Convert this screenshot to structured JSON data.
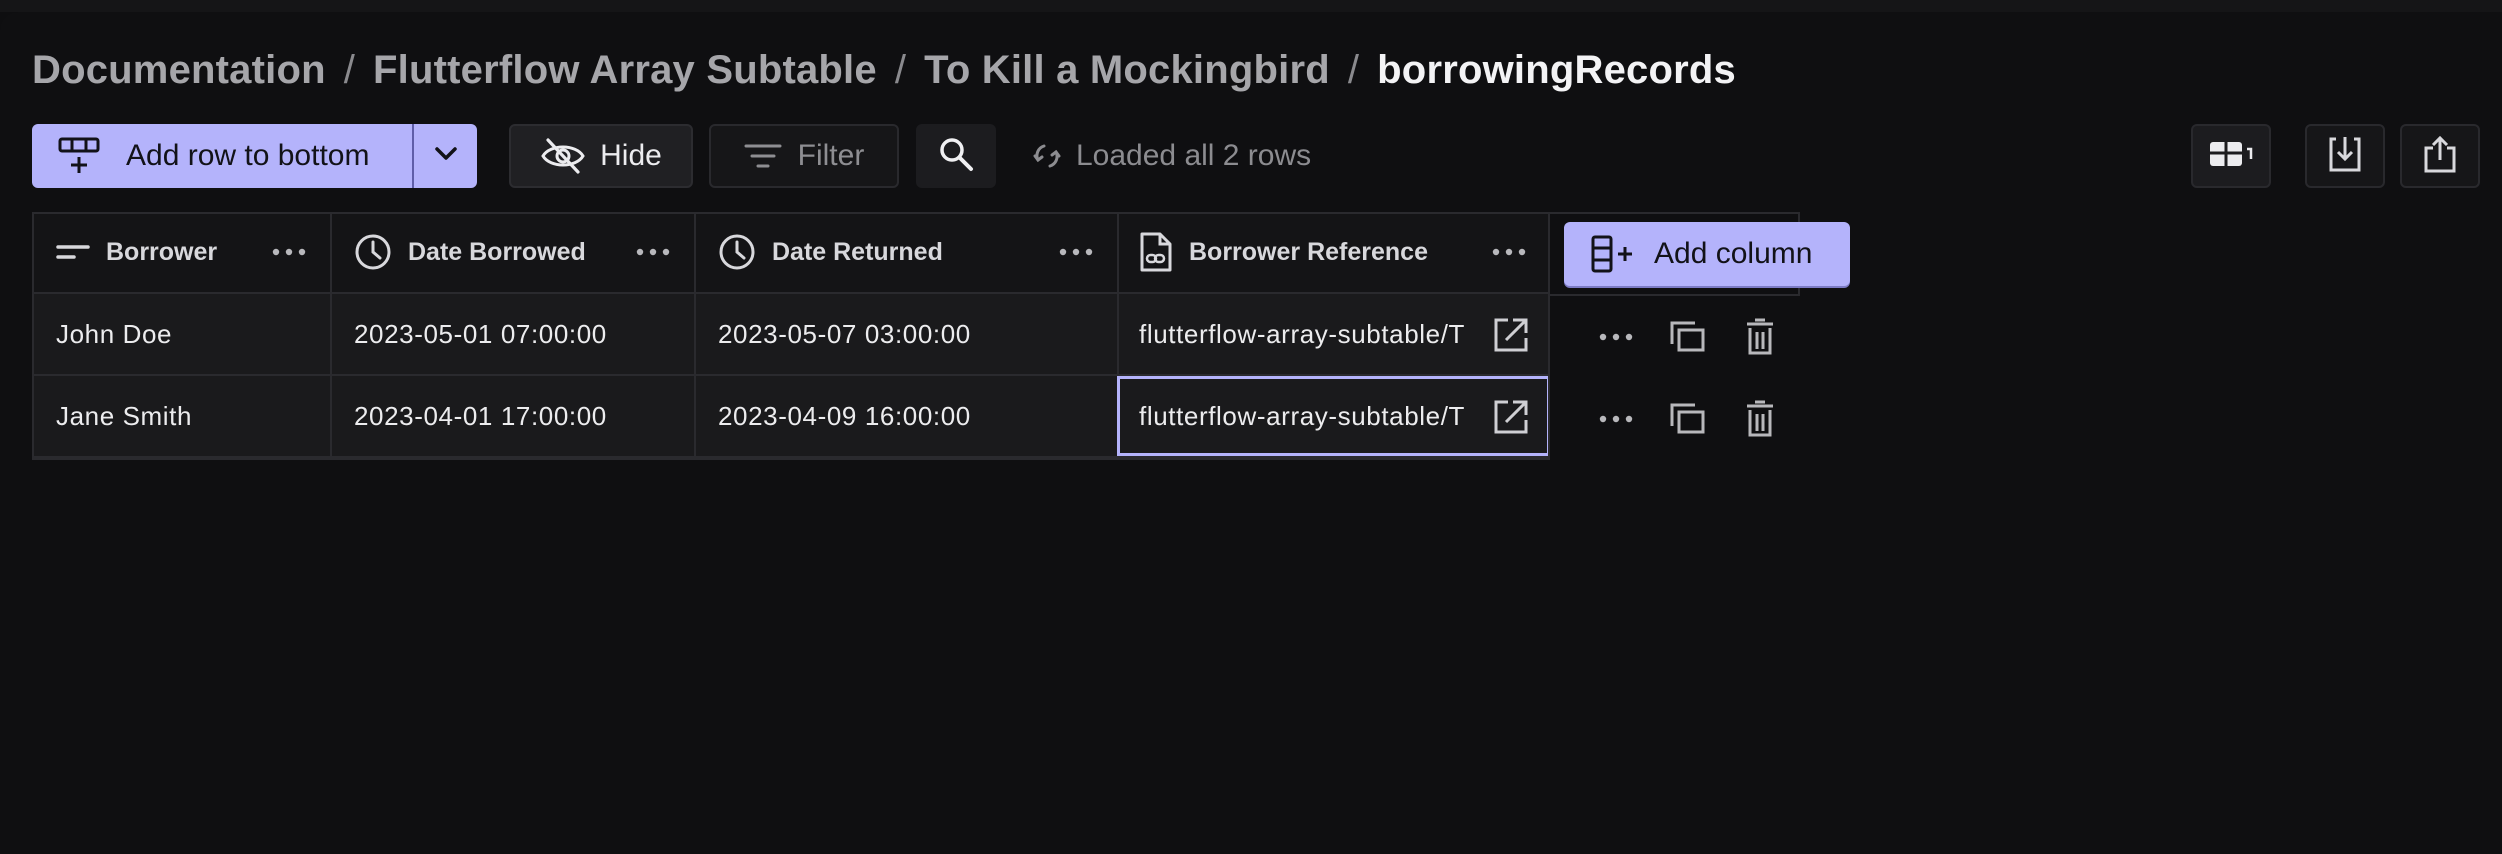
{
  "breadcrumb": {
    "items": [
      "Documentation",
      "Flutterflow Array Subtable",
      "To Kill a Mockingbird"
    ],
    "current": "borrowingRecords",
    "separator": "/"
  },
  "toolbar": {
    "add_row_label": "Add row to bottom",
    "hide_label": "Hide",
    "filter_label": "Filter",
    "status_text": "Loaded all 2 rows"
  },
  "table": {
    "columns": [
      {
        "label": "Borrower",
        "icon": "text-lines-icon"
      },
      {
        "label": "Date Borrowed",
        "icon": "clock-icon"
      },
      {
        "label": "Date Returned",
        "icon": "clock-icon"
      },
      {
        "label": "Borrower Reference",
        "icon": "document-link-icon"
      }
    ],
    "add_column_label": "Add column",
    "rows": [
      {
        "borrower": "John Doe",
        "date_borrowed": "2023-05-01 07:00:00",
        "date_returned": "2023-05-07 03:00:00",
        "reference": "flutterflow-array-subtable/T"
      },
      {
        "borrower": "Jane Smith",
        "date_borrowed": "2023-04-01 17:00:00",
        "date_returned": "2023-04-09 16:00:00",
        "reference": "flutterflow-array-subtable/T"
      }
    ]
  },
  "colors": {
    "accent": "#b4b3fb",
    "background": "#0f0f11",
    "cell_background": "#1a1a1c",
    "border": "#2a2a2e"
  }
}
